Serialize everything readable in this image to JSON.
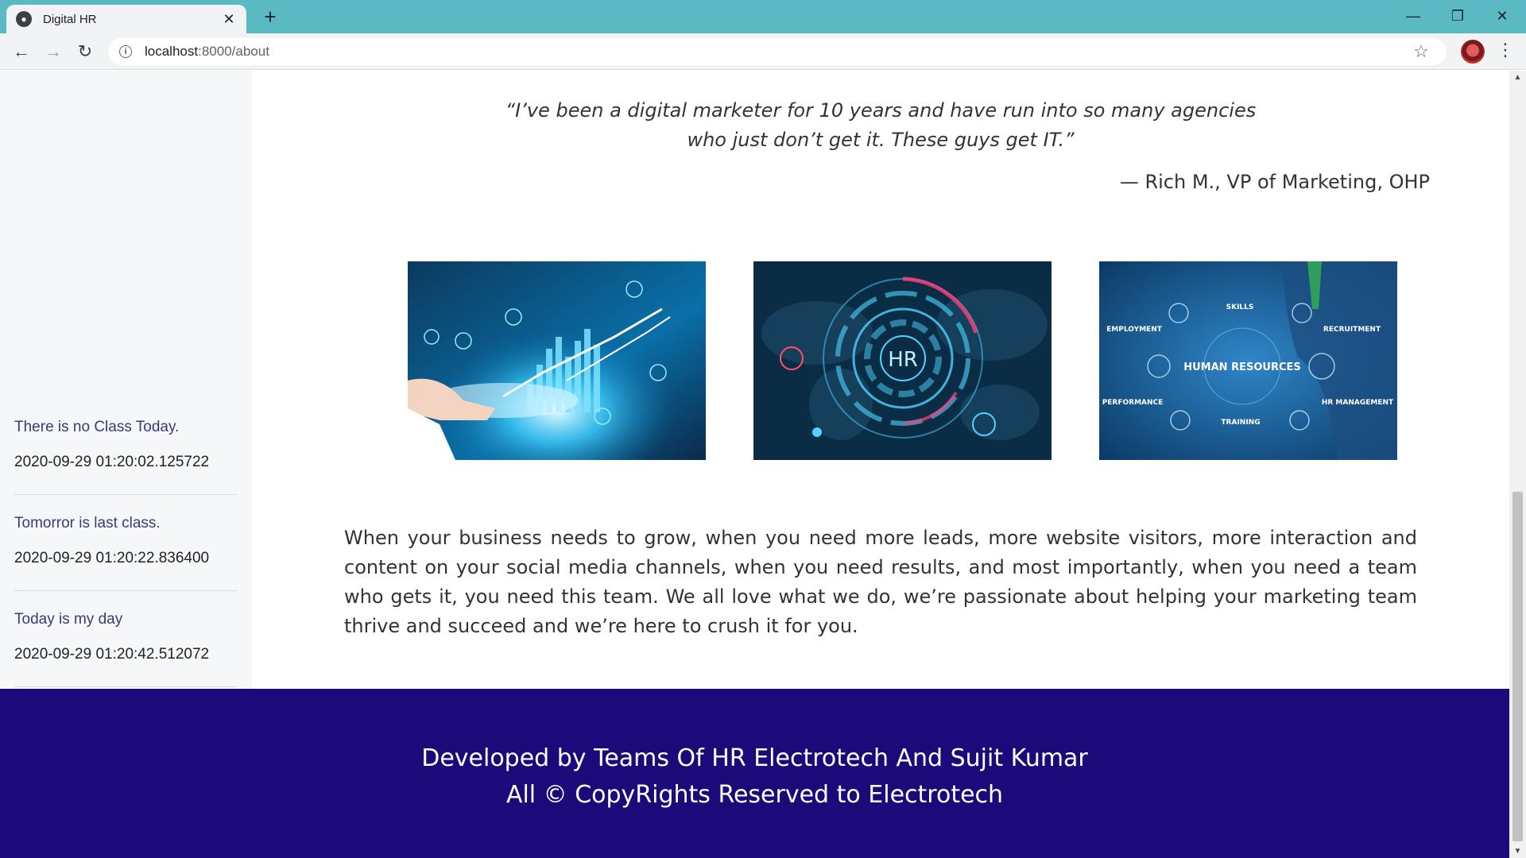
{
  "browser": {
    "tab_title": "Digital HR",
    "tab_close": "✕",
    "new_tab": "+",
    "url_host": "localhost",
    "url_path": ":8000/about",
    "window_controls": {
      "minimize": "—",
      "restore": "❐",
      "close": "✕"
    },
    "nav": {
      "back": "←",
      "forward": "→",
      "reload": "↻"
    },
    "info_icon": "i",
    "star_icon": "☆",
    "menu_icon": "⋮"
  },
  "sidebar": {
    "notices": [
      {
        "title": "There is no Class Today.",
        "time": "2020-09-29 01:20:02.125722"
      },
      {
        "title": "Tomorror is last class.",
        "time": "2020-09-29 01:20:22.836400"
      },
      {
        "title": "Today is my day",
        "time": "2020-09-29 01:20:42.512072"
      }
    ]
  },
  "main": {
    "quote_line1": "“I’ve been a digital marketer for 10 years and have run into so many agencies",
    "quote_line2": "who just don’t get it. These guys get IT.”",
    "attribution": "— Rich M., VP of Marketing, OHP",
    "images": [
      {
        "name": "digital-analytics-image"
      },
      {
        "name": "hr-hud-image",
        "label": "HR"
      },
      {
        "name": "human-resources-image",
        "center": "HUMAN RESOURCES",
        "labels": [
          "SKILLS",
          "EMPLOYMENT",
          "RECRUITMENT",
          "PERFORMANCE",
          "HR MANAGEMENT",
          "TRAINING"
        ]
      }
    ],
    "paragraph": "When your business needs to grow, when you need more leads, more website visitors, more interaction and content on your social media channels, when you need results, and most importantly, when you need a team who gets it, you need this team. We all love what we do, we’re passionate about helping your marketing team thrive and succeed and we’re here to crush it for you."
  },
  "footer": {
    "line1": "Developed by Teams Of HR Electrotech And Sujit Kumar",
    "line2": "All © CopyRights Reserved to Electrotech"
  },
  "colors": {
    "tabbar": "#5bb9c4",
    "footer": "#1c0a7a",
    "sidebar": "#f6f7f9",
    "notice_title": "#3a3a7a"
  }
}
